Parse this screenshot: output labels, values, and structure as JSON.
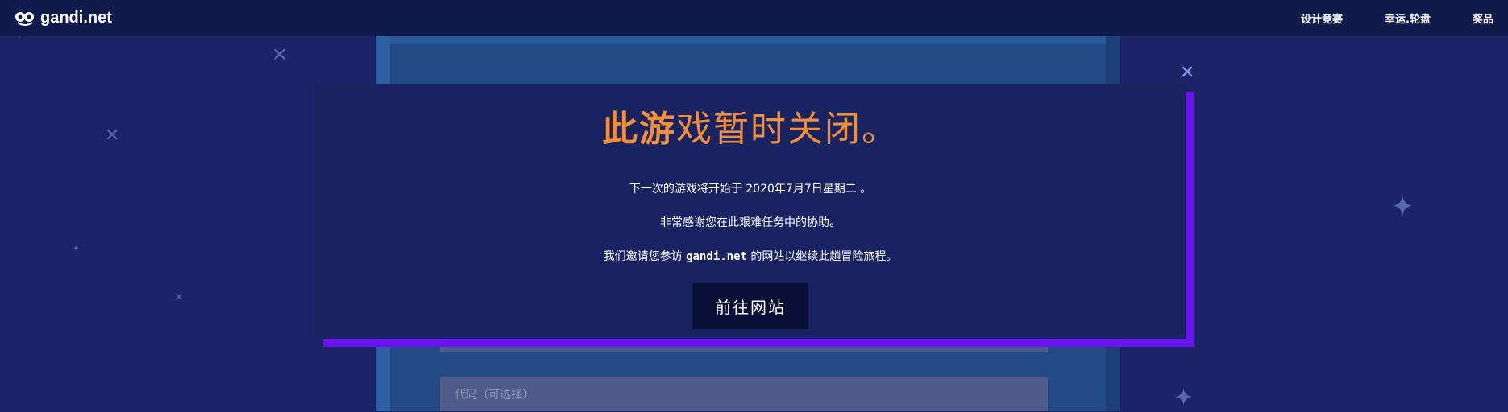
{
  "topbar": {
    "logo_text": "gandi.net",
    "nav": [
      "设计竞赛",
      "幸运.轮盘",
      "奖品"
    ]
  },
  "modal": {
    "title_bold": "此游",
    "title_rest": "戏暂时关闭。",
    "line1": "下一次的游戏将开始于 2020年7月7日星期二 。",
    "line2": "非常感谢您在此艰难任务中的协助。",
    "line3_pre": "我们邀请您参访 ",
    "line3_link": "gandi.net",
    "line3_post": " 的网站以继续此趟冒险旅程。",
    "cta": "前往网站"
  },
  "game": {
    "input_placeholder": "代码（可选择）"
  },
  "colors": {
    "background": "#1b2466",
    "title": "#ef8f3c",
    "accent": "#6a12f0"
  }
}
